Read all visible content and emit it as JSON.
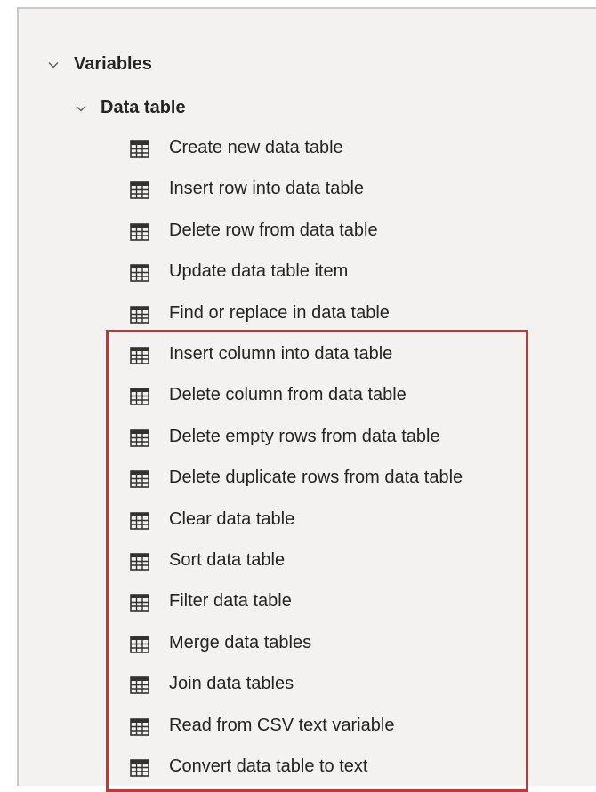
{
  "tree": {
    "group": {
      "label": "Variables",
      "expanded": true,
      "icon": "chevron-down-icon"
    },
    "subgroup": {
      "label": "Data table",
      "expanded": true,
      "icon": "chevron-down-icon"
    },
    "actions": [
      {
        "label": "Create new data table",
        "icon": "table-icon"
      },
      {
        "label": "Insert row into data table",
        "icon": "table-icon"
      },
      {
        "label": "Delete row from data table",
        "icon": "table-icon"
      },
      {
        "label": "Update data table item",
        "icon": "table-icon"
      },
      {
        "label": "Find or replace in data table",
        "icon": "table-icon"
      },
      {
        "label": "Insert column into data table",
        "icon": "table-icon",
        "highlighted": true
      },
      {
        "label": "Delete column from data table",
        "icon": "table-icon",
        "highlighted": true
      },
      {
        "label": "Delete empty rows from data table",
        "icon": "table-icon",
        "highlighted": true
      },
      {
        "label": "Delete duplicate rows from data table",
        "icon": "table-icon",
        "highlighted": true
      },
      {
        "label": "Clear data table",
        "icon": "table-icon",
        "highlighted": true
      },
      {
        "label": "Sort data table",
        "icon": "table-icon",
        "highlighted": true
      },
      {
        "label": "Filter data table",
        "icon": "table-icon",
        "highlighted": true
      },
      {
        "label": "Merge data tables",
        "icon": "table-icon",
        "highlighted": true
      },
      {
        "label": "Join data tables",
        "icon": "table-icon",
        "highlighted": true
      },
      {
        "label": "Read from CSV text variable",
        "icon": "table-icon",
        "highlighted": true
      },
      {
        "label": "Convert data table to text",
        "icon": "table-icon",
        "highlighted": true
      }
    ]
  },
  "colors": {
    "panel_background": "#f3f2f1",
    "text": "#252423",
    "highlight_border": "#d32f2f",
    "icon": "#323130"
  }
}
